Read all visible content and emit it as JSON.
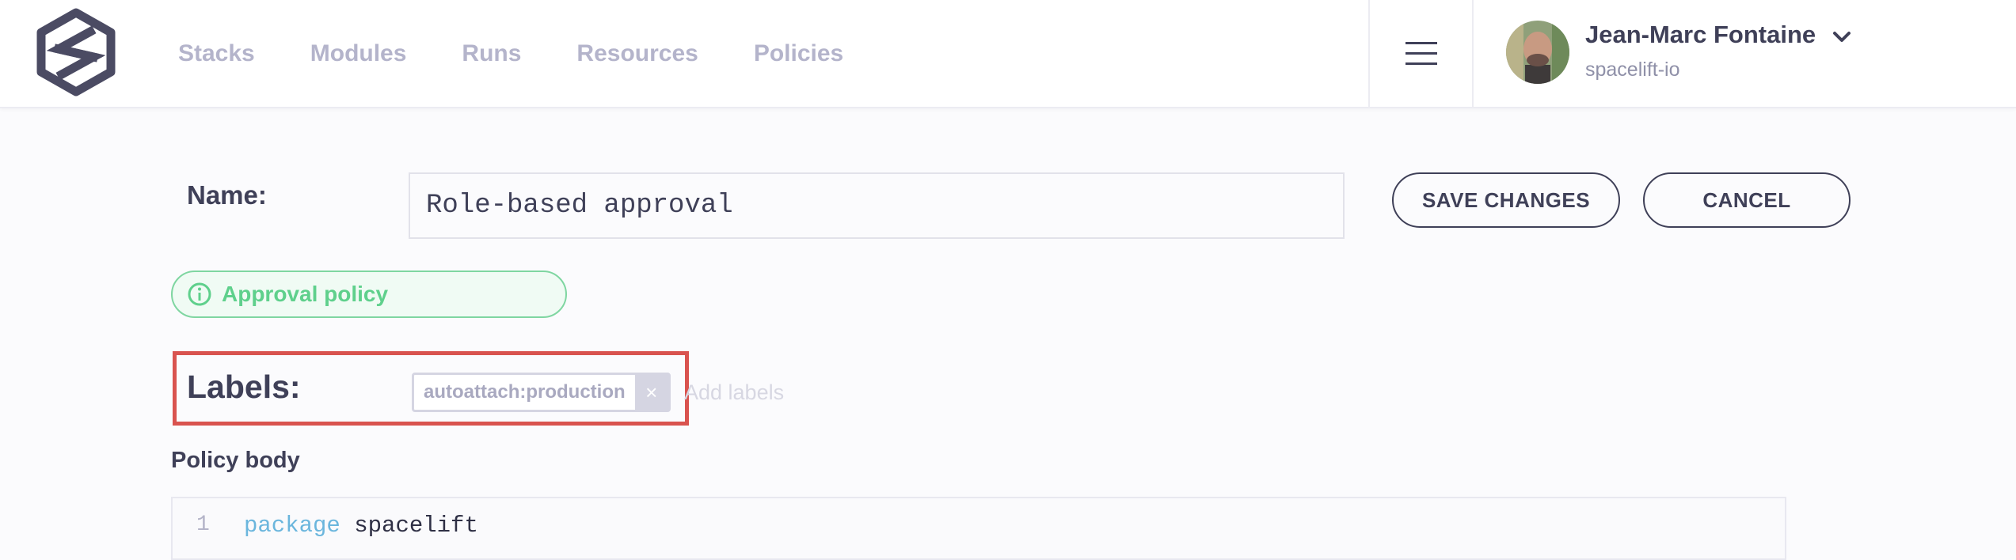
{
  "nav": {
    "items": [
      {
        "label": "Stacks"
      },
      {
        "label": "Modules"
      },
      {
        "label": "Runs"
      },
      {
        "label": "Resources"
      },
      {
        "label": "Policies"
      }
    ]
  },
  "user": {
    "name": "Jean-Marc Fontaine",
    "org": "spacelift-io"
  },
  "form": {
    "name_label": "Name:",
    "name_value": "Role-based approval",
    "save_label": "SAVE CHANGES",
    "cancel_label": "CANCEL",
    "policy_type": "Approval policy",
    "labels_label": "Labels:",
    "labels": [
      {
        "text": "autoattach:production",
        "remove": "×"
      }
    ],
    "add_labels_placeholder": "Add labels",
    "policy_body_title": "Policy body"
  },
  "editor": {
    "lines": [
      {
        "number": "1",
        "keyword": "package",
        "rest": " spacelift"
      }
    ]
  },
  "colors": {
    "accent_text": "#3f4058",
    "nav_inactive": "#b4b4cb",
    "policy_green": "#5fd08c",
    "highlight_red": "#d9534f",
    "keyword_blue": "#6bb6dd"
  },
  "icons": {
    "logo": "spacelift-logo",
    "menu": "hamburger-menu-icon",
    "chevron": "chevron-down-icon",
    "info": "info-icon",
    "remove": "close-icon"
  }
}
